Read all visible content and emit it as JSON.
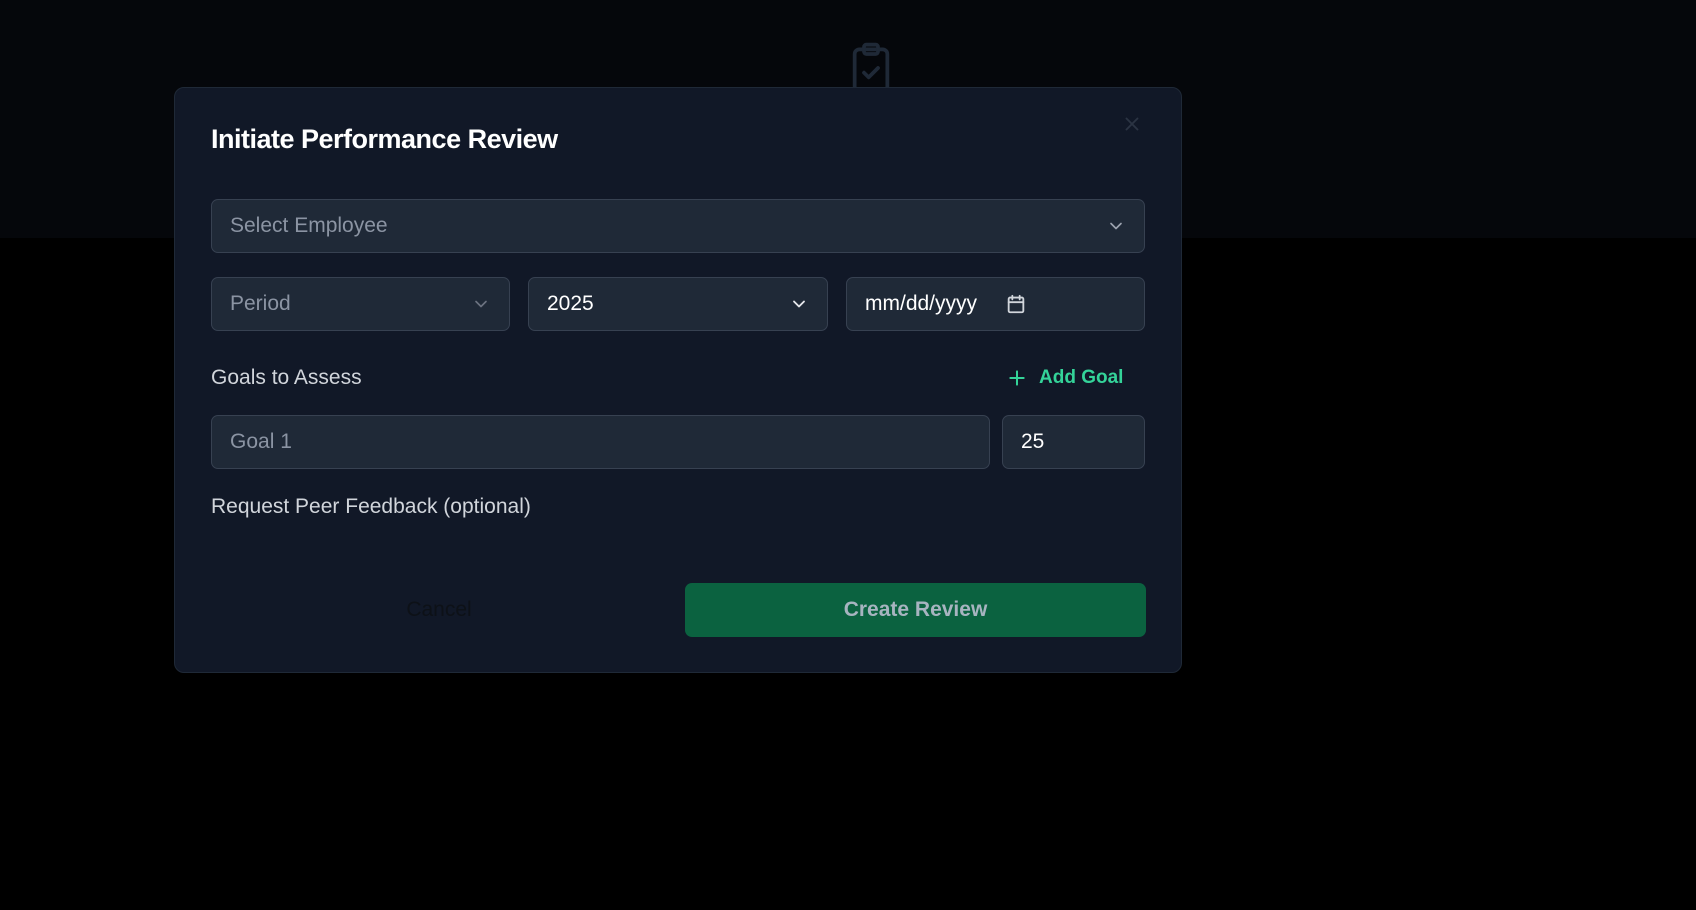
{
  "background": {
    "icon": "clipboard-check-icon"
  },
  "modal": {
    "title": "Initiate Performance Review",
    "close_icon": "close-icon"
  },
  "employee_select": {
    "placeholder": "Select Employee"
  },
  "period_select": {
    "placeholder": "Period"
  },
  "year_select": {
    "value": "2025"
  },
  "date_input": {
    "placeholder": "mm/dd/yyyy"
  },
  "goals": {
    "label": "Goals to Assess",
    "add_label": "Add Goal",
    "items": [
      {
        "placeholder": "Goal 1",
        "weight": "25"
      }
    ]
  },
  "peer_feedback": {
    "label": "Request Peer Feedback (optional)"
  },
  "actions": {
    "cancel": "Cancel",
    "create": "Create Review"
  },
  "colors": {
    "accent": "#34d399",
    "primary_button": "#0b6240",
    "modal_bg": "#111827",
    "field_bg": "#1f2937"
  }
}
